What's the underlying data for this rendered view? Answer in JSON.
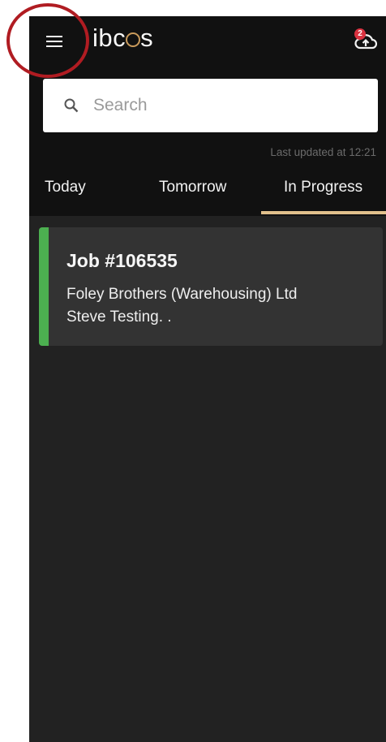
{
  "app": {
    "logo_prefix": "ib",
    "logo_mid": "c",
    "logo_suffix": "s"
  },
  "header": {
    "menu_icon": "hamburger-menu-icon",
    "upload_icon": "cloud-upload-icon",
    "upload_badge": "2"
  },
  "search": {
    "placeholder": "Search",
    "icon": "search-icon"
  },
  "status": {
    "last_updated": "Last updated at 12:21"
  },
  "tabs": [
    {
      "label": "Today",
      "active": false
    },
    {
      "label": "Tomorrow",
      "active": false
    },
    {
      "label": "In Progress",
      "active": true
    }
  ],
  "jobs": [
    {
      "title": "Job #106535",
      "customer": "Foley Brothers (Warehousing) Ltd",
      "description": "Steve Testing. .",
      "status_color": "#4caf50"
    }
  ],
  "colors": {
    "accent": "#e2c08c",
    "annotation_circle": "#b01c22",
    "badge": "#d93240",
    "background": "#222222",
    "appbar": "#111111"
  }
}
